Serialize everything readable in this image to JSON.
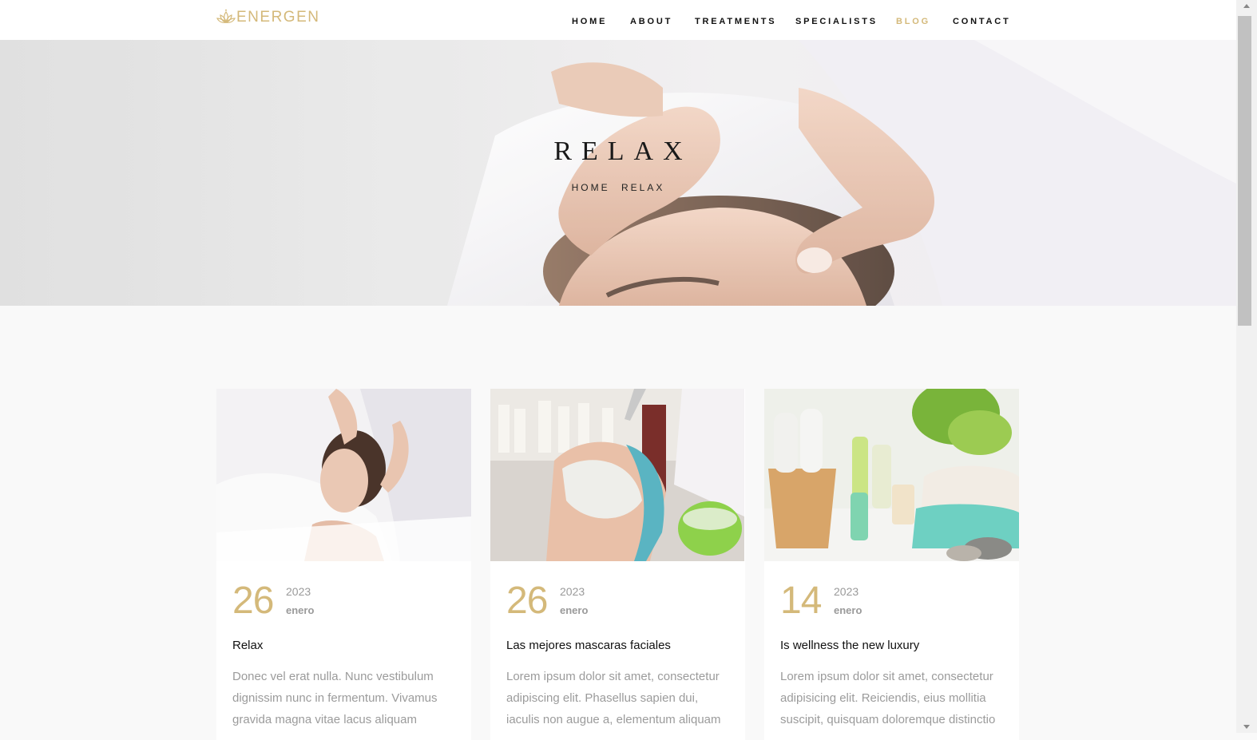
{
  "brand": {
    "name": "ENERGEN",
    "accent": "#d4b97a"
  },
  "nav": {
    "items": [
      {
        "label": "HOME"
      },
      {
        "label": "ABOUT"
      },
      {
        "label": "TREATMENTS"
      },
      {
        "label": "SPECIALISTS"
      },
      {
        "label": "BLOG",
        "active": true
      },
      {
        "label": "CONTACT"
      }
    ]
  },
  "hero": {
    "title": "RELAX",
    "breadcrumb": [
      "HOME",
      "RELAX"
    ]
  },
  "posts": [
    {
      "day": "26",
      "year": "2023",
      "month": "enero",
      "title": "Relax",
      "excerpt": "Donec vel erat nulla. Nunc vestibulum dignissim nunc in fermentum. Vivamus gravida magna vitae lacus aliquam",
      "image": "facial-massage-photo"
    },
    {
      "day": "26",
      "year": "2023",
      "month": "enero",
      "title": "Las mejores mascaras faciales",
      "excerpt": "Lorem ipsum dolor sit amet, consectetur adipiscing elit. Phasellus sapien dui, iaculis non augue a, elementum aliquam",
      "image": "face-mask-photo"
    },
    {
      "day": "14",
      "year": "2023",
      "month": "enero",
      "title": "Is wellness the new luxury",
      "excerpt": "Lorem ipsum dolor sit amet, consectetur adipisicing elit. Reiciendis, eius mollitia suscipit, quisquam doloremque distinctio",
      "image": "spa-products-photo"
    }
  ]
}
